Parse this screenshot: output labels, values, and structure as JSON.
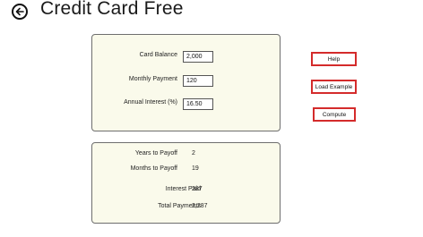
{
  "header": {
    "title": "Credit Card Free",
    "back_icon": "back-arrow-icon"
  },
  "inputs": {
    "card_balance": {
      "label": "Card Balance",
      "value": "2,000"
    },
    "monthly_payment": {
      "label": "Monthly Payment",
      "value": "120"
    },
    "annual_interest": {
      "label": "Annual Interest (%)",
      "value": "16.50"
    }
  },
  "results": {
    "years_to_payoff": {
      "label": "Years to Payoff",
      "value": "2"
    },
    "months_to_payoff": {
      "label": "Months to Payoff",
      "value": "19"
    },
    "interest_paid": {
      "label": "Interest Paid",
      "value": "287"
    },
    "total_payments": {
      "label": "Total Payments",
      "value": "2,287"
    }
  },
  "actions": {
    "help_label": "Help",
    "load_example_label": "Load Example",
    "compute_label": "Compute"
  },
  "colors": {
    "panel_background": "#fafaeb",
    "button_border": "#d42b2b"
  }
}
